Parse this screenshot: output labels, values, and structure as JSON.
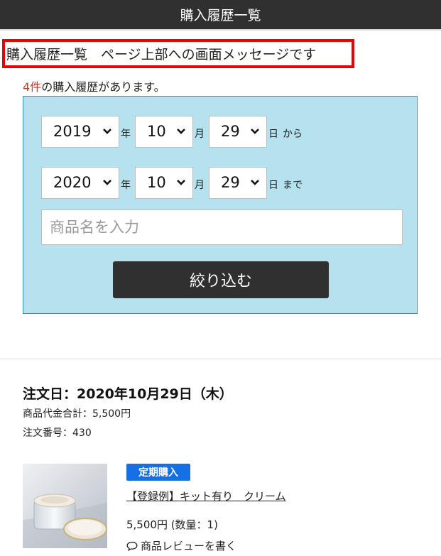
{
  "header": {
    "title": "購入履歴一覧"
  },
  "page_message": "購入履歴一覧　ページ上部への画面メッセージです",
  "summary": {
    "count": "4件",
    "suffix": "の購入履歴があります。"
  },
  "filter": {
    "from": {
      "year": "2019",
      "year_unit": "年",
      "month": "10",
      "month_unit": "月",
      "day": "29",
      "day_unit": "日",
      "suffix": "から"
    },
    "to": {
      "year": "2020",
      "year_unit": "年",
      "month": "10",
      "month_unit": "月",
      "day": "29",
      "day_unit": "日",
      "suffix": "まで"
    },
    "product_name_placeholder": "商品名を入力",
    "submit_label": "絞り込む"
  },
  "order": {
    "date_label": "注文日：2020年10月29日（木）",
    "subtotal_label": "商品代金合計：5,500円",
    "order_number_label": "注文番号：430",
    "item": {
      "badge": "定期購入",
      "name": "【登録例】キット有り　クリーム",
      "price_qty": "5,500円 (数量：1)",
      "review_label": "商品レビューを書く",
      "thumbnail_icon": "cream-jar-image"
    }
  },
  "colors": {
    "header_bg": "#303030",
    "message_border": "#ee0000",
    "count_accent": "#c0392b",
    "filter_bg": "#b6e2f0",
    "filter_border": "#1b9bc2",
    "badge_bg": "#1571e3"
  },
  "icons": {
    "select_arrow": "chevron-down-icon",
    "review": "speech-bubble-icon"
  }
}
